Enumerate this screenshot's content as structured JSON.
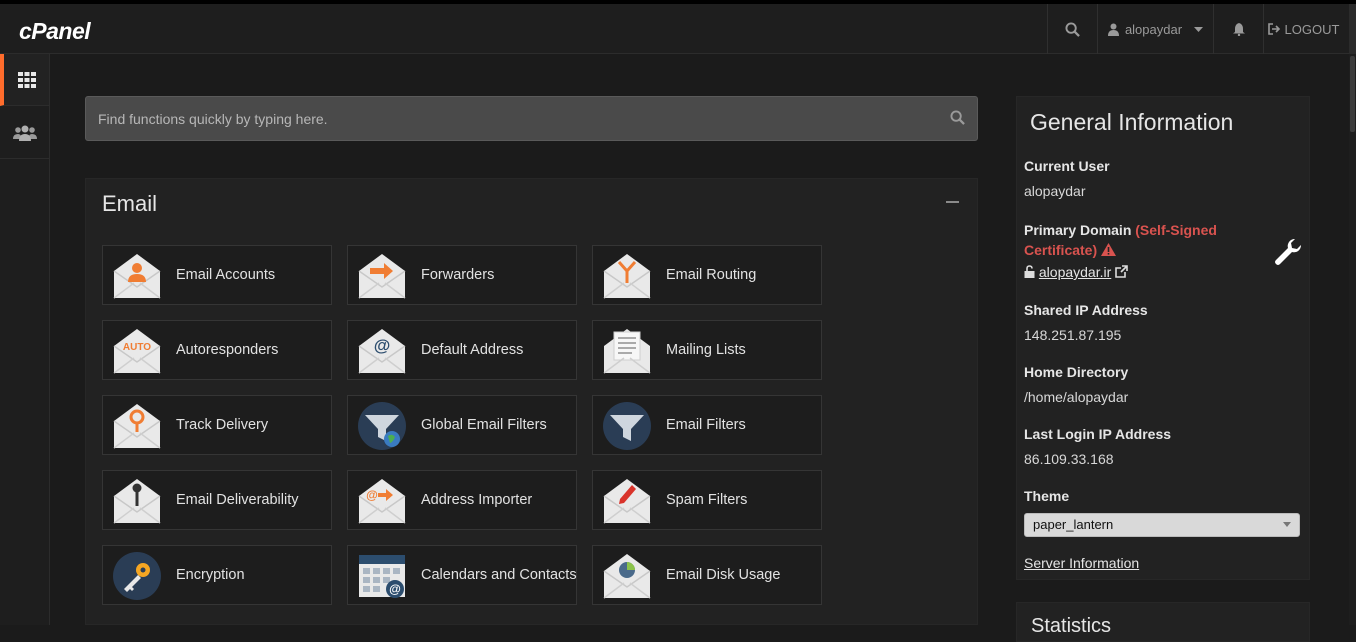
{
  "brand": {
    "logo": "cPanel"
  },
  "header": {
    "username": "alopaydar",
    "logout_label": "LOGOUT"
  },
  "search": {
    "placeholder": "Find functions quickly by typing here."
  },
  "email_section": {
    "title": "Email",
    "tiles": [
      {
        "label": "Email Accounts",
        "icon": "user-envelope-icon"
      },
      {
        "label": "Forwarders",
        "icon": "arrow-envelope-icon"
      },
      {
        "label": "Email Routing",
        "icon": "routing-envelope-icon"
      },
      {
        "label": "Autoresponders",
        "icon": "auto-envelope-icon",
        "badge": "AUTO"
      },
      {
        "label": "Default Address",
        "icon": "at-envelope-icon"
      },
      {
        "label": "Mailing Lists",
        "icon": "mailing-list-icon"
      },
      {
        "label": "Track Delivery",
        "icon": "location-envelope-icon"
      },
      {
        "label": "Global Email Filters",
        "icon": "globe-funnel-icon"
      },
      {
        "label": "Email Filters",
        "icon": "funnel-icon"
      },
      {
        "label": "Email Deliverability",
        "icon": "key-envelope-icon"
      },
      {
        "label": "Address Importer",
        "icon": "import-envelope-icon"
      },
      {
        "label": "Spam Filters",
        "icon": "pencil-envelope-icon"
      },
      {
        "label": "Encryption",
        "icon": "key-circle-icon"
      },
      {
        "label": "Calendars and Contacts",
        "icon": "calendar-icon"
      },
      {
        "label": "Email Disk Usage",
        "icon": "pie-envelope-icon"
      }
    ]
  },
  "general_info": {
    "title": "General Information",
    "current_user_label": "Current User",
    "current_user": "alopaydar",
    "primary_domain_label": "Primary Domain",
    "certificate_warning_line1": "(Self-Signed",
    "certificate_warning_line2": "Certificate)",
    "domain": "alopaydar.ir",
    "shared_ip_label": "Shared IP Address",
    "shared_ip": "148.251.87.195",
    "home_dir_label": "Home Directory",
    "home_dir": "/home/alopaydar",
    "last_login_label": "Last Login IP Address",
    "last_login_ip": "86.109.33.168",
    "theme_label": "Theme",
    "theme_value": "paper_lantern",
    "server_info_link": "Server Information"
  },
  "statistics": {
    "title": "Statistics"
  },
  "colors": {
    "accent": "#ff6c2c",
    "warning": "#d9534f",
    "panel": "#222222",
    "background": "#1b1b1b"
  }
}
